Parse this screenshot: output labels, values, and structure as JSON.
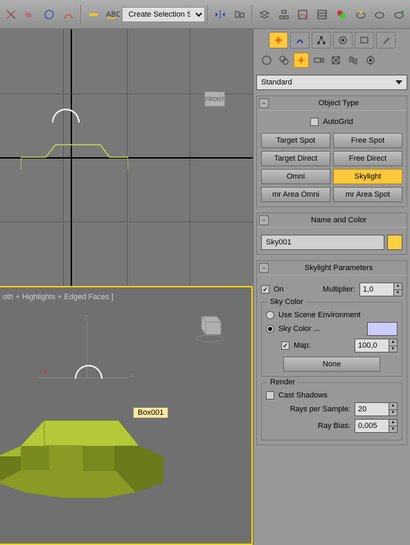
{
  "toolbar": {
    "selection_set": "Create Selection Se",
    "selection_set_char": "C"
  },
  "panel": {
    "dropdown": "Standard",
    "object_type": {
      "title": "Object Type",
      "autogrid": "AutoGrid",
      "buttons": [
        "Target Spot",
        "Free Spot",
        "Target Direct",
        "Free Direct",
        "Omni",
        "Skylight",
        "mr Area Omni",
        "mr Area Spot"
      ],
      "active": "Skylight"
    },
    "name_color": {
      "title": "Name and Color",
      "value": "Sky001",
      "color": "#ffd040"
    },
    "skylight_params": {
      "title": "Skylight Parameters",
      "on": "On",
      "multiplier_label": "Multiplier:",
      "multiplier_value": "1,0",
      "skycolor_legend": "Sky Color",
      "use_scene_env": "Use Scene Environment",
      "sky_color_label": "Sky Color ...",
      "map_label": "Map:",
      "map_value": "100,0",
      "none_btn": "None",
      "render_legend": "Render",
      "cast_shadows": "Cast Shadows",
      "rays_label": "Rays per Sample:",
      "rays_value": "20",
      "bias_label": "Ray Bias:",
      "bias_value": "0,005"
    }
  },
  "viewport": {
    "front_label": "FRONT",
    "box_label": "Box001",
    "shading_text": "oth + Highlights + Edged Faces ]",
    "gizmo_y": "Y"
  }
}
